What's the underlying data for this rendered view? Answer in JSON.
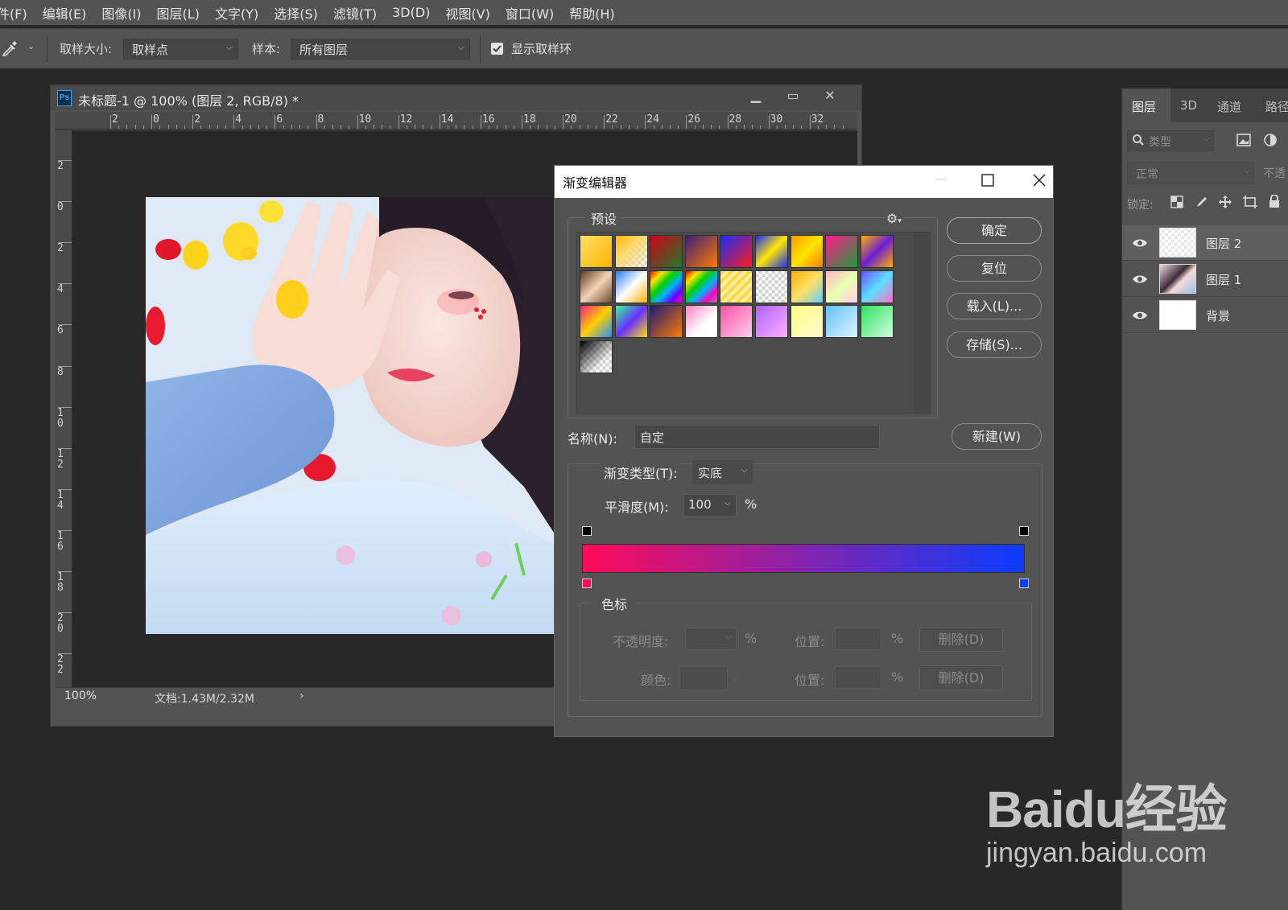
{
  "menu": [
    "件(F)",
    "编辑(E)",
    "图像(I)",
    "图层(L)",
    "文字(Y)",
    "选择(S)",
    "滤镜(T)",
    "3D(D)",
    "视图(V)",
    "窗口(W)",
    "帮助(H)"
  ],
  "options": {
    "sample_size_label": "取样大小:",
    "sample_size_value": "取样点",
    "sample_label": "样本:",
    "sample_value": "所有图层",
    "show_ring_label": "显示取样环",
    "show_ring_checked": true
  },
  "document": {
    "title": "未标题-1 @ 100% (图层 2, RGB/8) *",
    "zoom": "100%",
    "doc_info": "文档:1.43M/2.32M",
    "ruler_h": [
      "2",
      "0",
      "2",
      "4",
      "6",
      "8",
      "10",
      "12",
      "14",
      "16",
      "18",
      "20",
      "22",
      "24",
      "26",
      "28",
      "30",
      "32"
    ],
    "ruler_v": [
      "2",
      "0",
      "2",
      "4",
      "6",
      "8",
      "1\n0",
      "1\n2",
      "1\n4",
      "1\n6",
      "1\n8",
      "2\n0",
      "2\n2"
    ]
  },
  "layers_panel": {
    "tabs": [
      "图层",
      "3D",
      "通道",
      "路径"
    ],
    "search_placeholder": "类型",
    "blend_mode": "正常",
    "opacity_label": "不透",
    "lock_label": "锁定:",
    "layers": [
      {
        "name": "图层 2",
        "selected": true
      },
      {
        "name": "图层 1",
        "selected": false
      },
      {
        "name": "背景",
        "selected": false
      }
    ]
  },
  "gradient_editor": {
    "title": "渐变编辑器",
    "presets_label": "预设",
    "buttons": {
      "ok": "确定",
      "reset": "复位",
      "load": "载入(L)...",
      "save": "存储(S)...",
      "new": "新建(W)"
    },
    "name_label": "名称(N):",
    "name_value": "自定",
    "gradient_type_label": "渐变类型(T):",
    "gradient_type_value": "实底",
    "smoothness_label": "平滑度(M):",
    "smoothness_value": "100",
    "percent": "%",
    "stops_label": "色标",
    "opacity_label": "不透明度:",
    "location_label": "位置:",
    "delete_label": "删除(D)",
    "color_label": "颜色:",
    "gradient_colors": {
      "start": "#ff0a5a",
      "end": "#0a3cff"
    }
  },
  "watermark": {
    "brand": "Baidu经验",
    "url": "jingyan.baidu.com"
  }
}
